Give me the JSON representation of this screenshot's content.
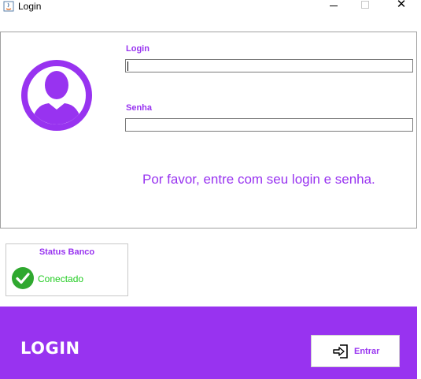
{
  "window": {
    "title": "Login",
    "minimize_symbol": "",
    "close_symbol": "✕"
  },
  "form": {
    "login_label": "Login",
    "login_value": "",
    "senha_label": "Senha",
    "senha_value": "",
    "message": "Por favor, entre com seu login e senha."
  },
  "status": {
    "title": "Status Banco",
    "text": "Conectado",
    "color": "#22cc22"
  },
  "footer": {
    "title": "LOGIN",
    "enter_label": "Entrar"
  },
  "colors": {
    "accent": "#9833f0",
    "success": "#22cc22"
  }
}
